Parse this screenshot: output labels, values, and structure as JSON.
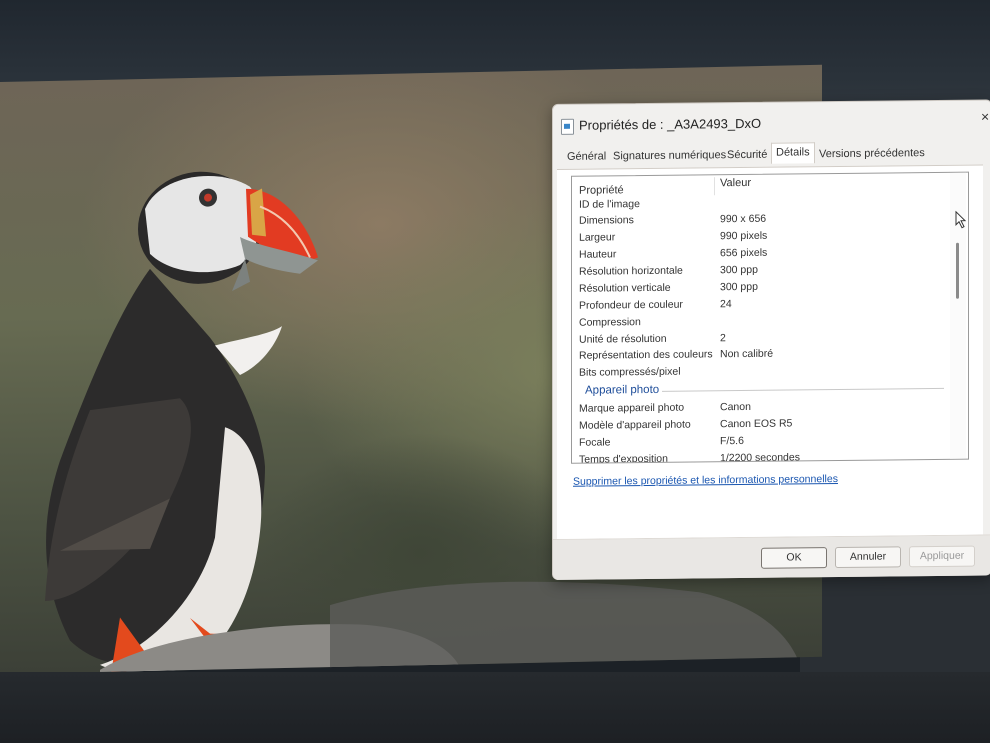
{
  "dialog": {
    "title": "Propriétés de : _A3A2493_DxO",
    "close_glyph": "×",
    "tabs": [
      {
        "label": "Général",
        "active": false
      },
      {
        "label": "Signatures numériques",
        "active": false
      },
      {
        "label": "Sécurité",
        "active": false
      },
      {
        "label": "Détails",
        "active": true
      },
      {
        "label": "Versions précédentes",
        "active": false
      }
    ],
    "columns": {
      "property": "Propriété",
      "value": "Valeur"
    },
    "rows": [
      {
        "property": "ID de l'image",
        "value": ""
      },
      {
        "property": "Dimensions",
        "value": "990 x 656"
      },
      {
        "property": "Largeur",
        "value": "990 pixels"
      },
      {
        "property": "Hauteur",
        "value": "656 pixels"
      },
      {
        "property": "Résolution horizontale",
        "value": "300 ppp"
      },
      {
        "property": "Résolution verticale",
        "value": "300 ppp"
      },
      {
        "property": "Profondeur de couleur",
        "value": "24"
      },
      {
        "property": "Compression",
        "value": ""
      },
      {
        "property": "Unité de résolution",
        "value": "2"
      },
      {
        "property": "Représentation des couleurs",
        "value": "Non calibré"
      },
      {
        "property": "Bits compressés/pixel",
        "value": ""
      }
    ],
    "group": "Appareil photo",
    "group_rows": [
      {
        "property": "Marque appareil photo",
        "value": "Canon"
      },
      {
        "property": "Modèle d'appareil photo",
        "value": "Canon EOS R5"
      },
      {
        "property": "Focale",
        "value": "F/5.6"
      },
      {
        "property": "Temps d'exposition",
        "value": "1/2200 secondes"
      }
    ],
    "remove_link": "Supprimer les propriétés et les informations personnelles",
    "buttons": {
      "ok": "OK",
      "cancel": "Annuler",
      "apply": "Appliquer"
    }
  },
  "icons": {
    "file": "image-file-icon",
    "cursor": "mouse-cursor-icon"
  },
  "colors": {
    "link": "#1a56b0",
    "group_heading": "#1f4e9a"
  }
}
